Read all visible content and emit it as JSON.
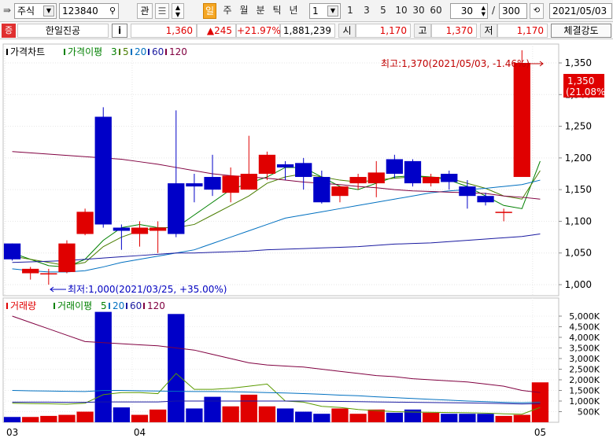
{
  "toolbar": {
    "market": "주식",
    "code": "123840",
    "favorite_label": "관",
    "period_selected": "일",
    "periods": [
      "주",
      "월",
      "분",
      "틱",
      "년"
    ],
    "interval_value": "1",
    "quick_intervals": [
      "1",
      "3",
      "5",
      "10",
      "30",
      "60"
    ],
    "count_value": "30",
    "count_separator": "/",
    "count_total": "300",
    "date": "2021/05/03"
  },
  "info": {
    "badge": "증",
    "name": "한일진공",
    "info_button": "i",
    "price": "1,360",
    "change": "▲245",
    "change_pct": "+21.97%",
    "volume": "1,881,239",
    "open_label": "시",
    "open": "1,170",
    "high_label": "고",
    "high": "1,370",
    "low_label": "저",
    "low": "1,170",
    "strength_button": "체결강도"
  },
  "price_panel": {
    "legend": {
      "title": "가격차트",
      "ma_title": "가격이평",
      "ma_periods": [
        "3",
        "5",
        "20",
        "60",
        "120"
      ]
    },
    "high_annotation": "최고:1,370(2021/05/03, -1.46%)",
    "low_annotation": "최저:1,000(2021/03/25, +35.00%)",
    "current_price_tag": "1,350",
    "current_pct_tag": "(21.08%)"
  },
  "volume_panel": {
    "legend": {
      "title": "거래량",
      "ma_title": "거래이평",
      "ma_periods": [
        "5",
        "20",
        "60",
        "120"
      ]
    }
  },
  "colors": {
    "up": "#e00000",
    "down": "#0000c8",
    "ma3": "#008000",
    "ma5": "#4a7d00",
    "ma20": "#0070c0",
    "ma60": "#1a1aa0",
    "ma120": "#800040"
  },
  "chart_data": {
    "type": "candlestick",
    "price_axis": {
      "min": 1000,
      "max": 1350,
      "ticks": [
        1000,
        1050,
        1100,
        1150,
        1200,
        1250,
        1300,
        1350
      ]
    },
    "volume_axis": {
      "min": 0,
      "max": 5000000,
      "ticks": [
        "500K",
        "1,000K",
        "1,500K",
        "2,000K",
        "2,500K",
        "3,000K",
        "3,500K",
        "4,000K",
        "4,500K",
        "5,000K"
      ],
      "tick_values": [
        500000,
        1000000,
        1500000,
        2000000,
        2500000,
        3000000,
        3500000,
        4000000,
        4500000,
        5000000
      ]
    },
    "x_labels": [
      {
        "index": 0,
        "label": "03"
      },
      {
        "index": 7,
        "label": "04"
      },
      {
        "index": 29,
        "label": "05"
      }
    ],
    "candles": [
      {
        "o": 1065,
        "h": 1065,
        "l": 1038,
        "c": 1040
      },
      {
        "o": 1018,
        "h": 1028,
        "l": 1008,
        "c": 1025
      },
      {
        "o": 1018,
        "h": 1025,
        "l": 1000,
        "c": 1018
      },
      {
        "o": 1020,
        "h": 1070,
        "l": 1018,
        "c": 1065
      },
      {
        "o": 1080,
        "h": 1120,
        "l": 1078,
        "c": 1115
      },
      {
        "o": 1265,
        "h": 1280,
        "l": 1090,
        "c": 1095
      },
      {
        "o": 1090,
        "h": 1095,
        "l": 1055,
        "c": 1085
      },
      {
        "o": 1080,
        "h": 1100,
        "l": 1060,
        "c": 1090
      },
      {
        "o": 1085,
        "h": 1100,
        "l": 1050,
        "c": 1090
      },
      {
        "o": 1160,
        "h": 1275,
        "l": 1075,
        "c": 1080
      },
      {
        "o": 1160,
        "h": 1175,
        "l": 1130,
        "c": 1155
      },
      {
        "o": 1170,
        "h": 1205,
        "l": 1140,
        "c": 1150
      },
      {
        "o": 1145,
        "h": 1185,
        "l": 1130,
        "c": 1172
      },
      {
        "o": 1150,
        "h": 1235,
        "l": 1150,
        "c": 1175
      },
      {
        "o": 1175,
        "h": 1210,
        "l": 1165,
        "c": 1205
      },
      {
        "o": 1190,
        "h": 1195,
        "l": 1165,
        "c": 1185
      },
      {
        "o": 1192,
        "h": 1200,
        "l": 1150,
        "c": 1170
      },
      {
        "o": 1170,
        "h": 1180,
        "l": 1128,
        "c": 1130
      },
      {
        "o": 1140,
        "h": 1155,
        "l": 1130,
        "c": 1155
      },
      {
        "o": 1160,
        "h": 1175,
        "l": 1150,
        "c": 1170
      },
      {
        "o": 1160,
        "h": 1195,
        "l": 1138,
        "c": 1177
      },
      {
        "o": 1198,
        "h": 1205,
        "l": 1168,
        "c": 1175
      },
      {
        "o": 1195,
        "h": 1198,
        "l": 1155,
        "c": 1160
      },
      {
        "o": 1160,
        "h": 1175,
        "l": 1155,
        "c": 1170
      },
      {
        "o": 1175,
        "h": 1180,
        "l": 1150,
        "c": 1162
      },
      {
        "o": 1155,
        "h": 1165,
        "l": 1120,
        "c": 1140
      },
      {
        "o": 1140,
        "h": 1145,
        "l": 1125,
        "c": 1130
      },
      {
        "o": 1115,
        "h": 1120,
        "l": 1100,
        "c": 1115
      },
      {
        "o": 1170,
        "h": 1370,
        "l": 1170,
        "c": 1350
      }
    ],
    "volumes": [
      250000,
      250000,
      300000,
      350000,
      500000,
      5200000,
      700000,
      350000,
      600000,
      5100000,
      650000,
      1200000,
      750000,
      1300000,
      750000,
      650000,
      500000,
      400000,
      650000,
      400000,
      600000,
      450000,
      600000,
      450000,
      400000,
      400000,
      400000,
      300000,
      350000,
      1880000
    ],
    "ma_price": {
      "ma3": [
        1050,
        1040,
        1030,
        1028,
        1040,
        1070,
        1090,
        1095,
        1090,
        1090,
        1110,
        1130,
        1150,
        1160,
        1170,
        1185,
        1185,
        1170,
        1155,
        1150,
        1160,
        1170,
        1172,
        1170,
        1165,
        1155,
        1140,
        1125,
        1120,
        1195
      ],
      "ma5": [
        1045,
        1040,
        1035,
        1030,
        1035,
        1060,
        1075,
        1085,
        1090,
        1090,
        1095,
        1110,
        1125,
        1140,
        1160,
        1170,
        1175,
        1170,
        1165,
        1162,
        1165,
        1168,
        1170,
        1170,
        1168,
        1160,
        1152,
        1140,
        1135,
        1180
      ],
      "ma20": [
        1025,
        1022,
        1020,
        1020,
        1022,
        1028,
        1035,
        1040,
        1045,
        1050,
        1055,
        1065,
        1075,
        1085,
        1095,
        1105,
        1110,
        1115,
        1120,
        1125,
        1130,
        1135,
        1140,
        1145,
        1148,
        1150,
        1152,
        1155,
        1158,
        1165
      ],
      "ma60": [
        1035,
        1036,
        1037,
        1038,
        1040,
        1042,
        1044,
        1046,
        1048,
        1050,
        1050,
        1051,
        1052,
        1053,
        1055,
        1056,
        1057,
        1058,
        1059,
        1060,
        1062,
        1064,
        1065,
        1066,
        1068,
        1070,
        1072,
        1074,
        1076,
        1080
      ],
      "ma120": [
        1210,
        1208,
        1206,
        1204,
        1202,
        1200,
        1198,
        1194,
        1190,
        1185,
        1180,
        1175,
        1172,
        1170,
        1168,
        1165,
        1162,
        1160,
        1158,
        1155,
        1153,
        1150,
        1148,
        1147,
        1146,
        1145,
        1144,
        1140,
        1138,
        1135
      ]
    },
    "ma_volume": {
      "ma5": [
        900000,
        880000,
        870000,
        850000,
        900000,
        1300000,
        1400000,
        1400000,
        1350000,
        2300000,
        1550000,
        1550000,
        1600000,
        1700000,
        1800000,
        1000000,
        950000,
        750000,
        700000,
        600000,
        550000,
        500000,
        480000,
        470000,
        460000,
        450000,
        430000,
        400000,
        380000,
        700000
      ],
      "ma20": [
        1500000,
        1480000,
        1470000,
        1460000,
        1450000,
        1500000,
        1500000,
        1480000,
        1470000,
        1460000,
        1450000,
        1450000,
        1440000,
        1420000,
        1400000,
        1380000,
        1350000,
        1320000,
        1280000,
        1250000,
        1200000,
        1160000,
        1120000,
        1080000,
        1040000,
        1000000,
        970000,
        940000,
        920000,
        950000
      ],
      "ma60": [
        950000,
        950000,
        950000,
        940000,
        940000,
        960000,
        960000,
        960000,
        960000,
        1000000,
        1000000,
        1000000,
        1000000,
        1000000,
        1000000,
        1000000,
        1000000,
        990000,
        980000,
        970000,
        960000,
        950000,
        940000,
        930000,
        920000,
        910000,
        900000,
        880000,
        860000,
        880000
      ],
      "ma120": [
        5000000,
        4700000,
        4400000,
        4100000,
        3800000,
        3750000,
        3700000,
        3650000,
        3600000,
        3500000,
        3400000,
        3200000,
        3000000,
        2800000,
        2700000,
        2650000,
        2600000,
        2500000,
        2400000,
        2300000,
        2200000,
        2150000,
        2050000,
        2000000,
        1950000,
        1900000,
        1800000,
        1700000,
        1500000,
        1400000
      ]
    }
  }
}
